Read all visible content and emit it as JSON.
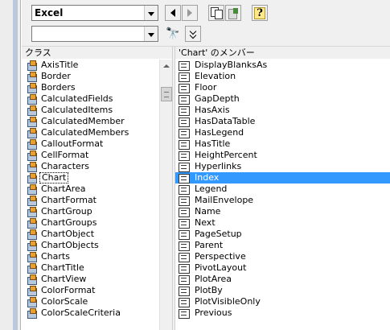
{
  "toolbar": {
    "library_combo_value": "Excel",
    "search_combo_value": ""
  },
  "classes_pane": {
    "header": "クラス",
    "items": [
      "AxisTitle",
      "Border",
      "Borders",
      "CalculatedFields",
      "CalculatedItems",
      "CalculatedMember",
      "CalculatedMembers",
      "CalloutFormat",
      "CellFormat",
      "Characters",
      "Chart",
      "ChartArea",
      "ChartFormat",
      "ChartGroup",
      "ChartGroups",
      "ChartObject",
      "ChartObjects",
      "Charts",
      "ChartTitle",
      "ChartView",
      "ColorFormat",
      "ColorScale",
      "ColorScaleCriteria"
    ],
    "focused_item": "Chart"
  },
  "members_pane": {
    "header": "'Chart' のメンバー",
    "items": [
      "DisplayBlanksAs",
      "Elevation",
      "Floor",
      "GapDepth",
      "HasAxis",
      "HasDataTable",
      "HasLegend",
      "HasTitle",
      "HeightPercent",
      "Hyperlinks",
      "Index",
      "Legend",
      "MailEnvelope",
      "Name",
      "Next",
      "PageSetup",
      "Parent",
      "Perspective",
      "PivotLayout",
      "PlotArea",
      "PlotBy",
      "PlotVisibleOnly",
      "Previous"
    ],
    "selected_item": "Index"
  },
  "colors": {
    "selection": "#3399ff",
    "toolbar_bg": "#f0f0f0"
  }
}
